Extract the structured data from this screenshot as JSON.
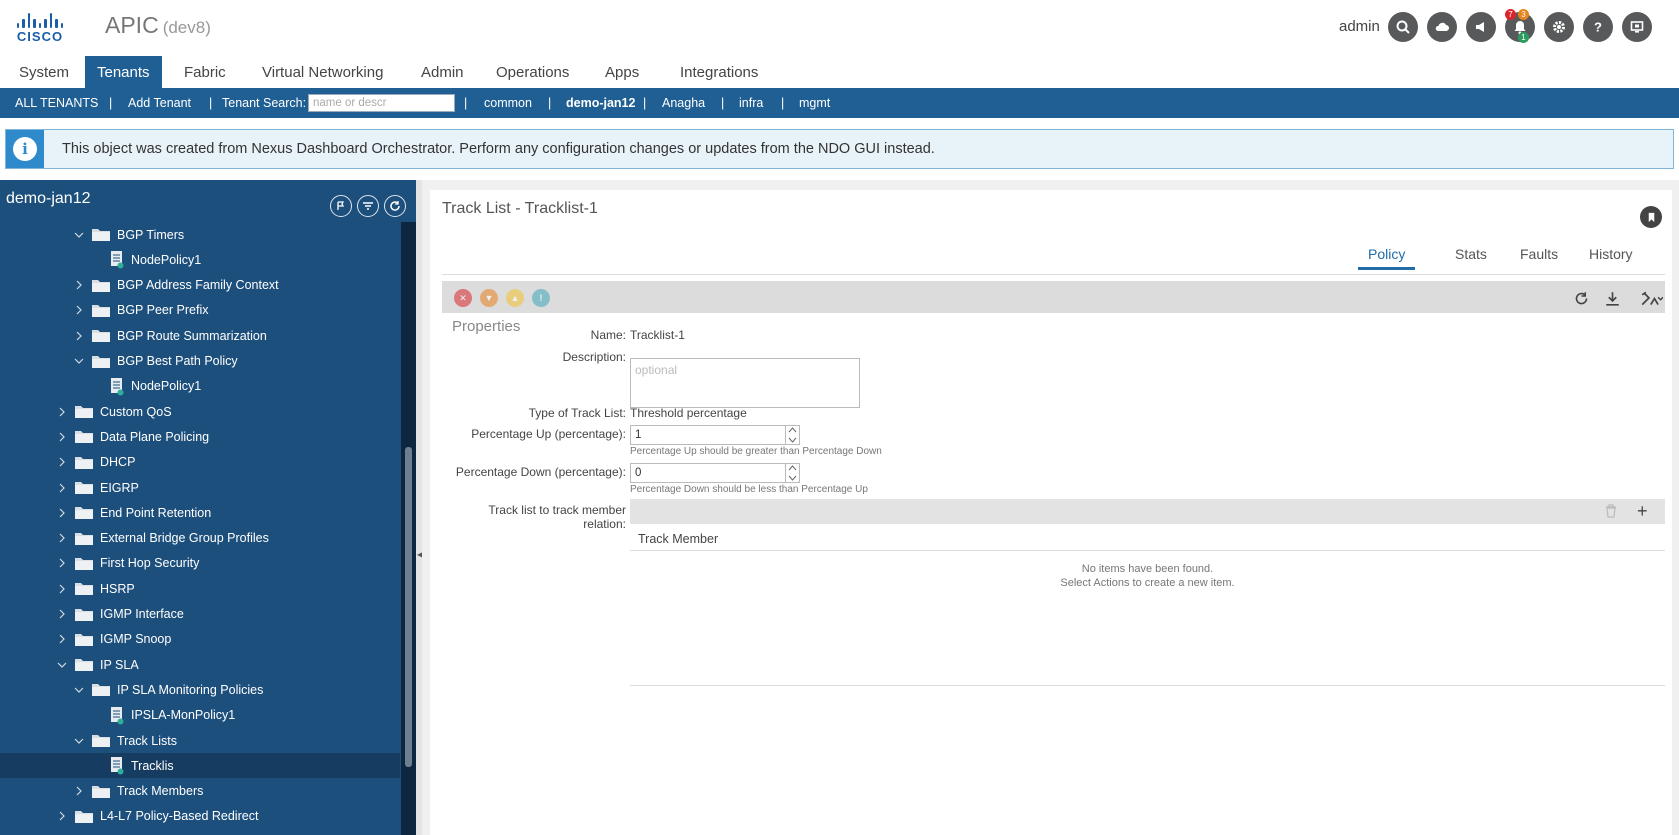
{
  "header": {
    "logo_text": "CISCO",
    "app_title": "APIC",
    "app_subtitle": "(dev8)",
    "user": "admin",
    "notif_badge_red": "7",
    "notif_badge_orange": "3",
    "notif_badge_green": "1",
    "icons": [
      "search-icon",
      "cloud-icon",
      "announcement-icon",
      "bell-icon",
      "gear-icon",
      "help-icon",
      "screen-icon"
    ]
  },
  "tabs": [
    "System",
    "Tenants",
    "Fabric",
    "Virtual Networking",
    "Admin",
    "Operations",
    "Apps",
    "Integrations"
  ],
  "active_tab": "Tenants",
  "subnav": {
    "all_tenants": "ALL TENANTS",
    "add_tenant": "Add Tenant",
    "tenant_search_label": "Tenant Search:",
    "tenant_search_placeholder": "name or descr",
    "separator": "|",
    "tenants": [
      "common",
      "demo-jan12",
      "Anagha",
      "infra",
      "mgmt"
    ]
  },
  "banner": {
    "icon": "info-icon",
    "text": "This object was created from Nexus Dashboard Orchestrator. Perform any configuration changes or updates from the NDO GUI instead."
  },
  "left_panel": {
    "title": "demo-jan12",
    "icons": [
      "topology-icon",
      "filter-icon",
      "refresh-icon"
    ],
    "tree": [
      {
        "label": "BGP Timers",
        "type": "folder",
        "level": 2,
        "expanded": true
      },
      {
        "label": "NodePolicy1",
        "type": "policy",
        "level": 3
      },
      {
        "label": "BGP Address Family Context",
        "type": "folder",
        "level": 2,
        "expanded": false
      },
      {
        "label": "BGP Peer Prefix",
        "type": "folder",
        "level": 2,
        "expanded": false
      },
      {
        "label": "BGP Route Summarization",
        "type": "folder",
        "level": 2,
        "expanded": false
      },
      {
        "label": "BGP Best Path Policy",
        "type": "folder",
        "level": 2,
        "expanded": true
      },
      {
        "label": "NodePolicy1",
        "type": "policy",
        "level": 3
      },
      {
        "label": "Custom QoS",
        "type": "folder",
        "level": 1,
        "expanded": false
      },
      {
        "label": "Data Plane Policing",
        "type": "folder",
        "level": 1,
        "expanded": false
      },
      {
        "label": "DHCP",
        "type": "folder",
        "level": 1,
        "expanded": false
      },
      {
        "label": "EIGRP",
        "type": "folder",
        "level": 1,
        "expanded": false
      },
      {
        "label": "End Point Retention",
        "type": "folder",
        "level": 1,
        "expanded": false
      },
      {
        "label": "External Bridge Group Profiles",
        "type": "folder",
        "level": 1,
        "expanded": false
      },
      {
        "label": "First Hop Security",
        "type": "folder",
        "level": 1,
        "expanded": false
      },
      {
        "label": "HSRP",
        "type": "folder",
        "level": 1,
        "expanded": false
      },
      {
        "label": "IGMP Interface",
        "type": "folder",
        "level": 1,
        "expanded": false
      },
      {
        "label": "IGMP Snoop",
        "type": "folder",
        "level": 1,
        "expanded": false
      },
      {
        "label": "IP SLA",
        "type": "folder",
        "level": 1,
        "expanded": true
      },
      {
        "label": "IP SLA Monitoring Policies",
        "type": "folder",
        "level": 2,
        "expanded": true
      },
      {
        "label": "IPSLA-MonPolicy1",
        "type": "policy",
        "level": 3
      },
      {
        "label": "Track Lists",
        "type": "folder",
        "level": 2,
        "expanded": true
      },
      {
        "label": "Tracklis",
        "type": "policy",
        "level": 3,
        "selected": true
      },
      {
        "label": "Track Members",
        "type": "folder",
        "level": 2,
        "expanded": false
      },
      {
        "label": "L4-L7 Policy-Based Redirect",
        "type": "folder",
        "level": 1,
        "expanded": false
      }
    ]
  },
  "detail": {
    "title": "Track List - Tracklist-1",
    "tabs": [
      "Policy",
      "Stats",
      "Faults",
      "History"
    ],
    "active_tab": "Policy",
    "toolbar_icons": [
      "critical-fault-icon",
      "major-fault-icon",
      "minor-fault-icon",
      "warning-fault-icon",
      "refresh-icon",
      "download-icon",
      "tools-icon"
    ],
    "section_title": "Properties",
    "name_label": "Name:",
    "name_value": "Tracklist-1",
    "description_label": "Description:",
    "description_placeholder": "optional",
    "type_label": "Type of Track List:",
    "type_value": "Threshold percentage",
    "pct_up_label": "Percentage Up (percentage):",
    "pct_up_value": "1",
    "pct_up_hint": "Percentage Up should be greater than Percentage Down",
    "pct_down_label": "Percentage Down (percentage):",
    "pct_down_value": "0",
    "pct_down_hint": "Percentage Down should be less than Percentage Up",
    "relation_label_1": "Track list to track member",
    "relation_label_2": "relation:",
    "table_header": "Track Member",
    "empty_line_1": "No items have been found.",
    "empty_line_2": "Select Actions to create a new item."
  }
}
